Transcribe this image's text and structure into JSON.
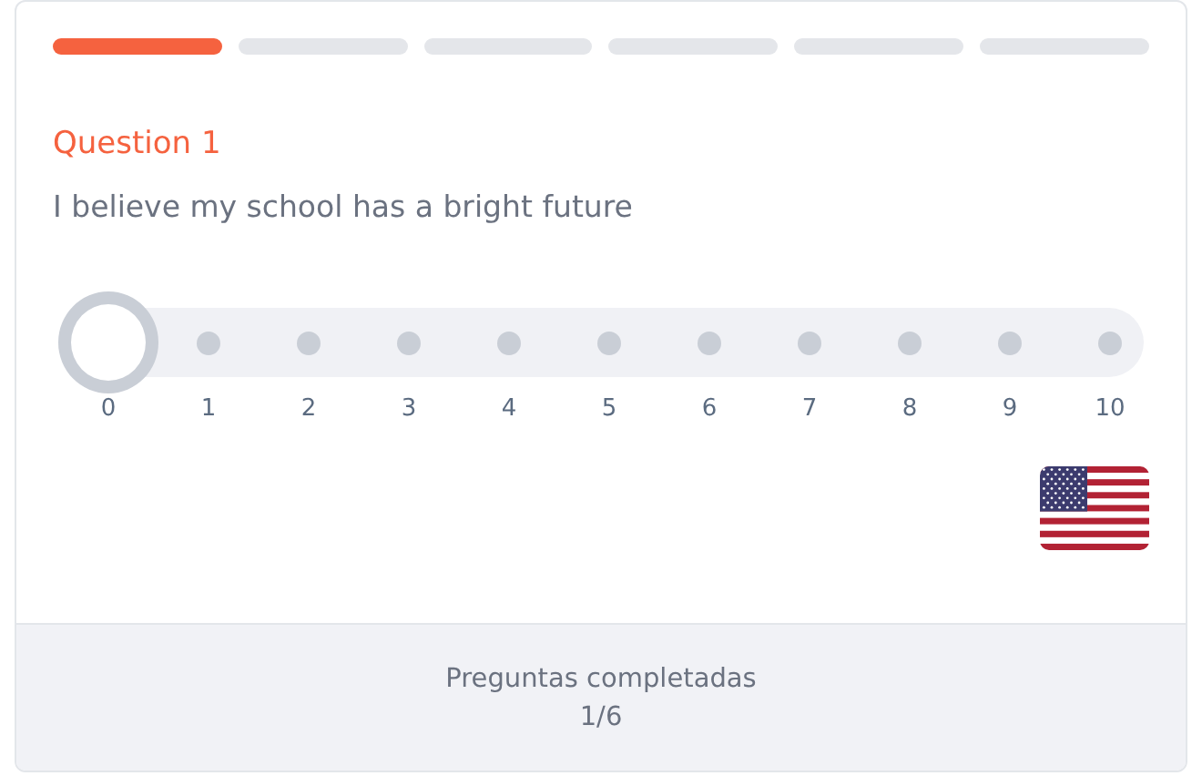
{
  "progress": [
    {
      "selected": true
    },
    {
      "selected": false
    },
    {
      "selected": false
    },
    {
      "selected": false
    },
    {
      "selected": false
    },
    {
      "selected": false
    }
  ],
  "question": {
    "label": "Question 1",
    "text": "I believe my school has a bright future"
  },
  "scale": [
    {
      "label": "0",
      "selected": true
    },
    {
      "label": "1",
      "selected": false
    },
    {
      "label": "2",
      "selected": false
    },
    {
      "label": "3",
      "selected": false
    },
    {
      "label": "4",
      "selected": false
    },
    {
      "label": "5",
      "selected": false
    },
    {
      "label": "6",
      "selected": false
    },
    {
      "label": "7",
      "selected": false
    },
    {
      "label": "8",
      "selected": false
    },
    {
      "label": "9",
      "selected": false
    },
    {
      "label": "10",
      "selected": false
    }
  ],
  "footer": {
    "title": "Preguntas completadas",
    "count": "1/6"
  }
}
